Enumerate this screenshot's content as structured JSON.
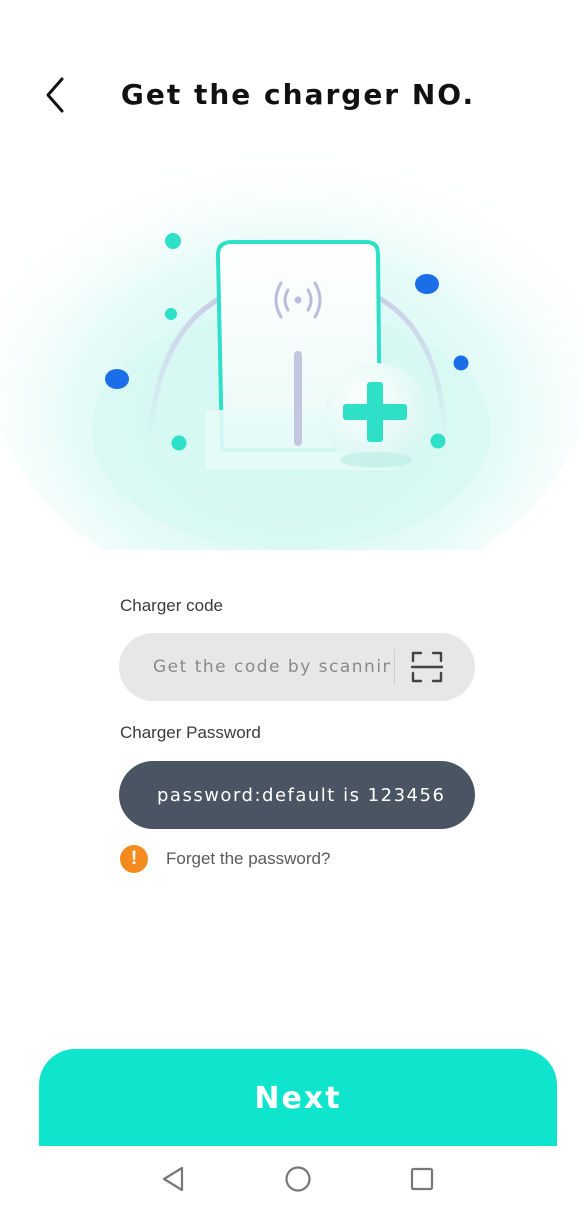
{
  "header": {
    "title": "Get the charger NO.",
    "back_icon": "chevron-left-icon"
  },
  "illustration": {
    "icon": "charger-add-illustration",
    "accent_color": "#2ee0c8",
    "dot_color": "#1a6ee8"
  },
  "form": {
    "code_label": "Charger code",
    "code_placeholder": "Get the code by scanning",
    "scan_icon": "scan-icon",
    "password_label": "Charger Password",
    "password_placeholder": "password:default is 123456",
    "forget_text": "Forget the password?",
    "warning_icon": "warning-icon",
    "warning_glyph": "!"
  },
  "actions": {
    "next_label": "Next",
    "next_color": "#0fe5cd"
  },
  "nav_bar": {
    "back_icon": "triangle-back-icon",
    "home_icon": "circle-home-icon",
    "recent_icon": "square-recent-icon"
  }
}
